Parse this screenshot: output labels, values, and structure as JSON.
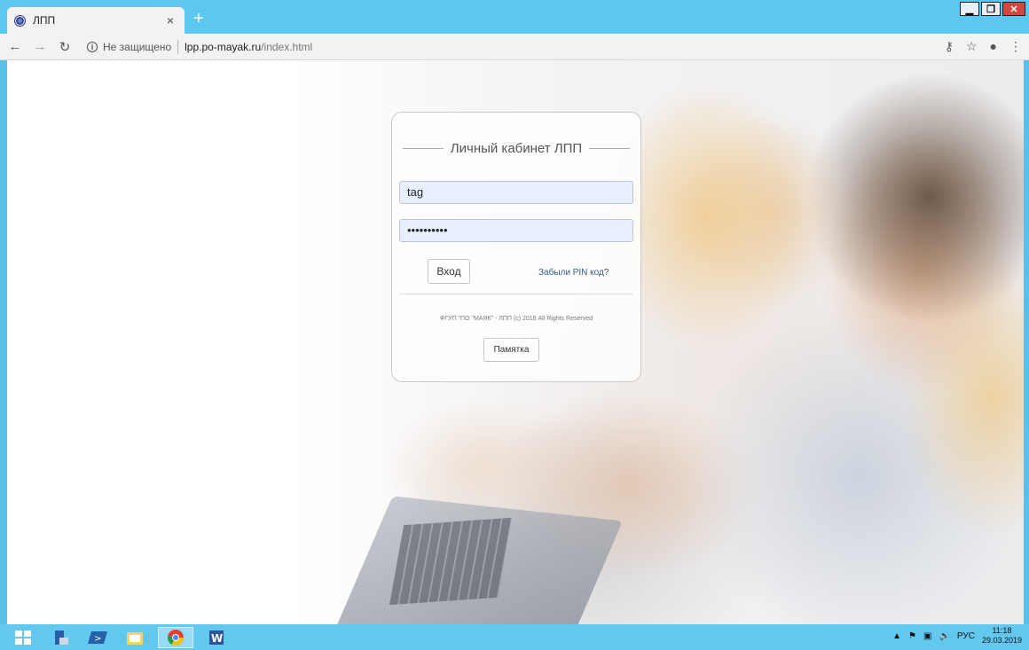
{
  "browser": {
    "tab_title": "ЛПП",
    "tab_close": "×",
    "new_tab": "+",
    "not_secure": "Не защищено",
    "url_host": "lpp.po-mayak.ru",
    "url_path": "/index.html"
  },
  "login": {
    "title": "Личный кабинет ЛПП",
    "username_value": "tag",
    "password_value": "••••••••••",
    "login_button": "Вход",
    "forgot_link": "Забыли PIN код?",
    "copyright": "ФГУП \"ПО \"МАЯК\" - ЛПП (c) 2018 All Rights Reserved",
    "memo_button": "Памятка"
  },
  "taskbar": {
    "language": "РУС",
    "time": "11:18",
    "date": "29.03.2019"
  },
  "icons": {
    "back": "back-arrow-icon",
    "forward": "forward-arrow-icon",
    "reload": "reload-icon",
    "key": "key-icon",
    "star": "star-icon",
    "account": "account-icon",
    "menu": "menu-icon"
  },
  "colors": {
    "titlebar": "#5cc8ef",
    "taskbar": "#62c8ee",
    "input_fill": "#e8f0fe",
    "link": "#36578c"
  }
}
